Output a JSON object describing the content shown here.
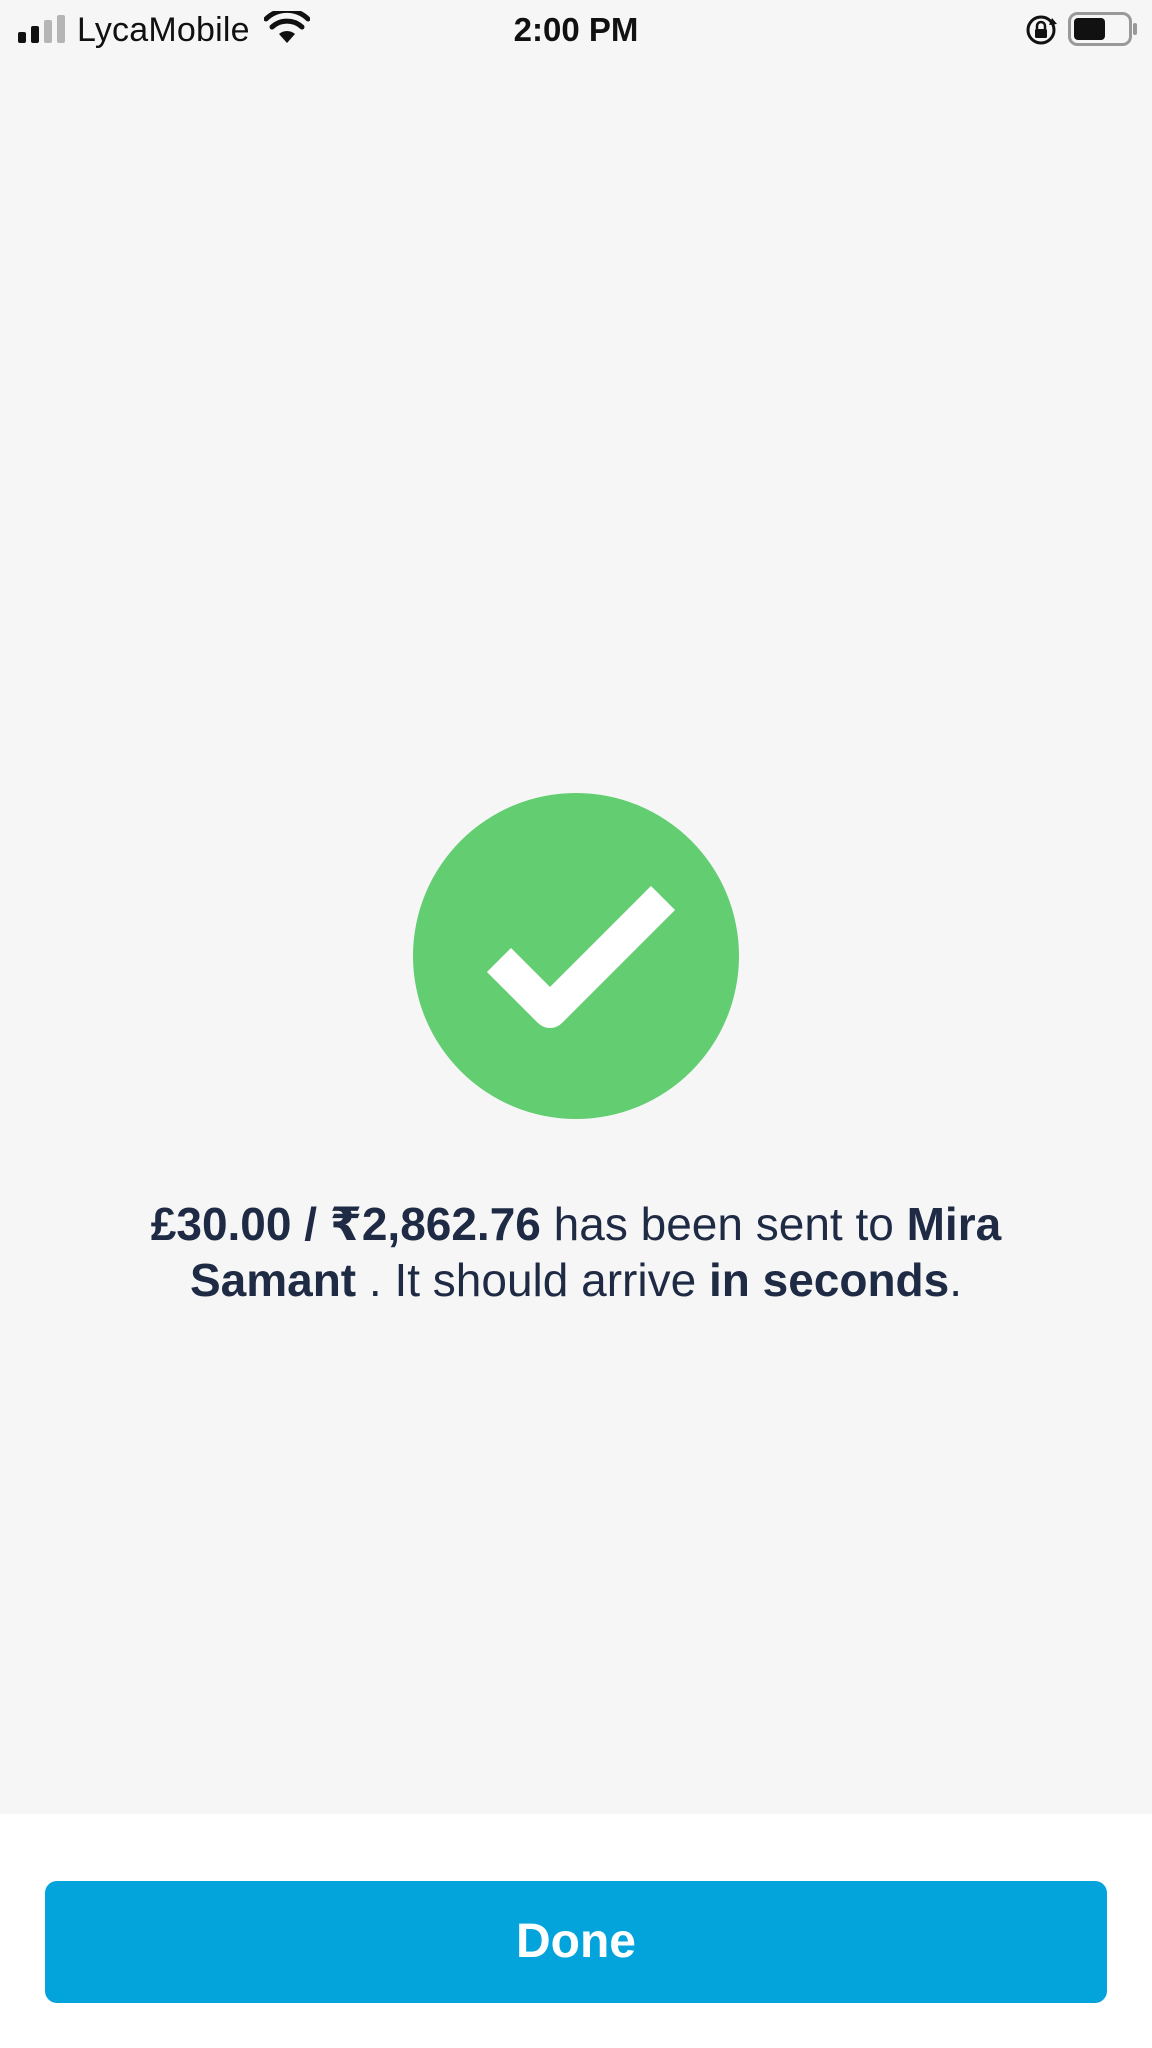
{
  "status_bar": {
    "carrier": "LycaMobile",
    "time": "2:00 PM",
    "icons": [
      "signal-icon",
      "wifi-icon",
      "rotation-lock-icon",
      "battery-icon"
    ]
  },
  "success": {
    "icon": "checkmark-circle-icon",
    "icon_color": "#63cd71",
    "amount": "£30.00 / ₹2,862.76",
    "text_before_recipient": " has been sent to ",
    "recipient": "Mira Samant",
    "text_before_timing": " . It should arrive ",
    "timing": "in seconds",
    "text_end": "."
  },
  "actions": {
    "done_label": "Done",
    "button_color": "#03a4db"
  }
}
